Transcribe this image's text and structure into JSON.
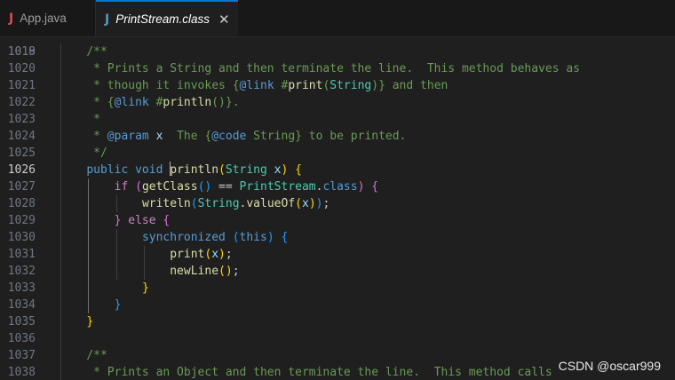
{
  "tabs": [
    {
      "icon": "java-file-icon",
      "glyph": "J",
      "label": "App.java",
      "active": false
    },
    {
      "icon": "java-file-icon",
      "glyph": "J",
      "label": "PrintStream.class",
      "active": true,
      "close": "✕"
    }
  ],
  "editor": {
    "current_line": "1026",
    "partial_top_line": "1018",
    "lines": [
      {
        "num": "1019",
        "tokens": [
          [
            "c-comment",
            "/**"
          ]
        ]
      },
      {
        "num": "1020",
        "tokens": [
          [
            "c-comment",
            " * Prints a String and then terminate the line.  This method behaves as"
          ]
        ]
      },
      {
        "num": "1021",
        "tokens": [
          [
            "c-comment",
            " * though it invokes "
          ],
          [
            "c-comment",
            "{"
          ],
          [
            "c-tag",
            "@link"
          ],
          [
            "c-comment",
            " #"
          ],
          [
            "c-fn",
            "print"
          ],
          [
            "c-comment",
            "("
          ],
          [
            "c-type",
            "String"
          ],
          [
            "c-comment",
            ")"
          ],
          [
            "c-comment",
            "}"
          ],
          [
            "c-comment",
            " and then"
          ]
        ]
      },
      {
        "num": "1022",
        "tokens": [
          [
            "c-comment",
            " * {"
          ],
          [
            "c-tag",
            "@link"
          ],
          [
            "c-comment",
            " #"
          ],
          [
            "c-fn",
            "println"
          ],
          [
            "c-comment",
            "()"
          ],
          [
            "c-comment",
            "}."
          ]
        ]
      },
      {
        "num": "1023",
        "tokens": [
          [
            "c-comment",
            " *"
          ]
        ]
      },
      {
        "num": "1024",
        "tokens": [
          [
            "c-comment",
            " * "
          ],
          [
            "c-tag",
            "@param"
          ],
          [
            "c-var",
            " x"
          ],
          [
            "c-comment",
            "  The {"
          ],
          [
            "c-tag",
            "@code"
          ],
          [
            "c-comment",
            " String} to be printed."
          ]
        ]
      },
      {
        "num": "1025",
        "tokens": [
          [
            "c-comment",
            " */"
          ]
        ]
      },
      {
        "num": "1026",
        "tokens": [
          [
            "c-kw",
            "public"
          ],
          [
            "c-plain",
            " "
          ],
          [
            "c-kw",
            "void"
          ],
          [
            "c-plain",
            " "
          ],
          [
            "caret",
            ""
          ],
          [
            "c-fn",
            "println"
          ],
          [
            "c-b1",
            "("
          ],
          [
            "c-type",
            "String"
          ],
          [
            "c-plain",
            " "
          ],
          [
            "c-var",
            "x"
          ],
          [
            "c-b1",
            ")"
          ],
          [
            "c-plain",
            " "
          ],
          [
            "c-b1",
            "{"
          ]
        ]
      },
      {
        "num": "1027",
        "tokens": [
          [
            "c-plain",
            "    "
          ],
          [
            "c-ctrl",
            "if"
          ],
          [
            "c-plain",
            " "
          ],
          [
            "c-b2",
            "("
          ],
          [
            "c-fn",
            "getClass"
          ],
          [
            "c-b3",
            "()"
          ],
          [
            "c-plain",
            " == "
          ],
          [
            "c-type",
            "PrintStream"
          ],
          [
            "c-plain",
            "."
          ],
          [
            "c-kw",
            "class"
          ],
          [
            "c-b2",
            ")"
          ],
          [
            "c-plain",
            " "
          ],
          [
            "c-b2",
            "{"
          ]
        ]
      },
      {
        "num": "1028",
        "tokens": [
          [
            "c-plain",
            "        "
          ],
          [
            "c-fn",
            "writeln"
          ],
          [
            "c-b3",
            "("
          ],
          [
            "c-type",
            "String"
          ],
          [
            "c-plain",
            "."
          ],
          [
            "c-fn",
            "valueOf"
          ],
          [
            "c-b1",
            "("
          ],
          [
            "c-var",
            "x"
          ],
          [
            "c-b1",
            ")"
          ],
          [
            "c-b3",
            ")"
          ],
          [
            "c-plain",
            ";"
          ]
        ]
      },
      {
        "num": "1029",
        "tokens": [
          [
            "c-plain",
            "    "
          ],
          [
            "c-b2",
            "}"
          ],
          [
            "c-plain",
            " "
          ],
          [
            "c-ctrl",
            "else"
          ],
          [
            "c-plain",
            " "
          ],
          [
            "c-b2",
            "{"
          ]
        ]
      },
      {
        "num": "1030",
        "tokens": [
          [
            "c-plain",
            "        "
          ],
          [
            "c-kw",
            "synchronized"
          ],
          [
            "c-plain",
            " "
          ],
          [
            "c-b3",
            "("
          ],
          [
            "c-kw",
            "this"
          ],
          [
            "c-b3",
            ")"
          ],
          [
            "c-plain",
            " "
          ],
          [
            "c-b3",
            "{"
          ]
        ]
      },
      {
        "num": "1031",
        "tokens": [
          [
            "c-plain",
            "            "
          ],
          [
            "c-fn",
            "print"
          ],
          [
            "c-b1",
            "("
          ],
          [
            "c-var",
            "x"
          ],
          [
            "c-b1",
            ")"
          ],
          [
            "c-plain",
            ";"
          ]
        ]
      },
      {
        "num": "1032",
        "tokens": [
          [
            "c-plain",
            "            "
          ],
          [
            "c-fn",
            "newLine"
          ],
          [
            "c-b1",
            "()"
          ],
          [
            "c-plain",
            ";"
          ]
        ]
      },
      {
        "num": "1033",
        "tokens": [
          [
            "c-plain",
            "        "
          ],
          [
            "c-b1",
            "}"
          ]
        ]
      },
      {
        "num": "1034",
        "tokens": [
          [
            "c-plain",
            "    "
          ],
          [
            "c-b3",
            "}"
          ]
        ]
      },
      {
        "num": "1035",
        "tokens": [
          [
            "c-b1",
            "}"
          ]
        ]
      },
      {
        "num": "1036",
        "tokens": []
      },
      {
        "num": "1037",
        "tokens": [
          [
            "c-comment",
            "/**"
          ]
        ]
      },
      {
        "num": "1038",
        "tokens": [
          [
            "c-comment",
            " * Prints an Object and then terminate the line.  This method calls"
          ]
        ]
      }
    ]
  },
  "watermark": "CSDN @oscar999"
}
